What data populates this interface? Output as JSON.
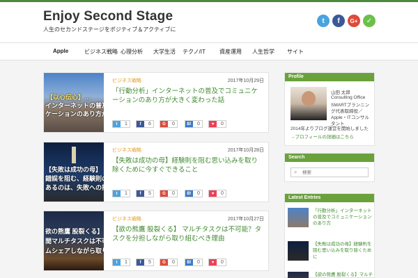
{
  "site": {
    "title": "Enjoy Second Stage",
    "subtitle": "人生のセカンドステージをポジティブ＆アクティブに"
  },
  "social_icons": [
    {
      "name": "twitter-icon",
      "glyph": "t",
      "color": "#4aa3df"
    },
    {
      "name": "facebook-icon",
      "glyph": "f",
      "color": "#3b5998"
    },
    {
      "name": "googleplus-icon",
      "glyph": "G+",
      "color": "#dd4b39"
    },
    {
      "name": "feedly-icon",
      "glyph": "✓",
      "color": "#6cc04a"
    }
  ],
  "nav": [
    "Apple",
    "ビジネス戦略",
    "心理分析",
    "大学生活",
    "テクノ/IT",
    "資産運用",
    "人生哲学",
    "サイト"
  ],
  "posts": [
    {
      "category": "ビジネス戦略",
      "date": "2017年10月29日",
      "title": "「行動分析」インターネットの普及でコミュニケーションのあり方が大きく変わった話",
      "thumb_lines": [
        "【以心伝心】…",
        "インターネットの普及で",
        "ケーションのあり方が大きく"
      ],
      "shares": {
        "twitter": "1",
        "facebook": "6",
        "google": "0",
        "hatena": "0",
        "pocket": "0"
      }
    },
    {
      "category": "ビジネス戦略",
      "date": "2017年10月28日",
      "title": "【失敗は成功の母】経験則を阻む思い込みを取り除くために今すぐできること",
      "thumb_lines": [
        "【失敗は成功の母】",
        "錯誤を阻む、経験則の根",
        "あるのは、失敗への拒絶"
      ],
      "shares": {
        "twitter": "1",
        "facebook": "5",
        "google": "0",
        "hatena": "0",
        "pocket": "0"
      }
    },
    {
      "category": "ビジネス戦略",
      "date": "2017年10月27日",
      "title": "【欲の熊鷹 股裂くる】 マルチタスクは不可能？タスクを分担しながら取り組むべき理由",
      "thumb_lines": [
        "欲の熊鷹 股裂くる】",
        "間マルチタスクは不可能",
        "ムシェアしながら取り組"
      ],
      "shares": {
        "twitter": "1",
        "facebook": "5",
        "google": "0",
        "hatena": "0",
        "pocket": "0"
      }
    }
  ],
  "sidebar": {
    "profile": {
      "heading": "Profile",
      "name": "山田 太郎",
      "org": "Consulting Office",
      "desc": "SMARTプランニング代表取締役／Apple・ITコンサルタント",
      "bio": "2014年よりブログ運営を開始しました",
      "link": "→プロフィールの詳細はこちら"
    },
    "search": {
      "heading": "Search",
      "placeholder": "検索"
    },
    "latest": {
      "heading": "Latest Entries",
      "items": [
        "「行動分析」インターネットの普及でコミュニケーションのあり方",
        "【失敗は成功の母】経験則を阻む思い込みを取り除くために",
        "【欲の熊鷹 股裂くる】マルチタスクは不可能？"
      ]
    }
  }
}
